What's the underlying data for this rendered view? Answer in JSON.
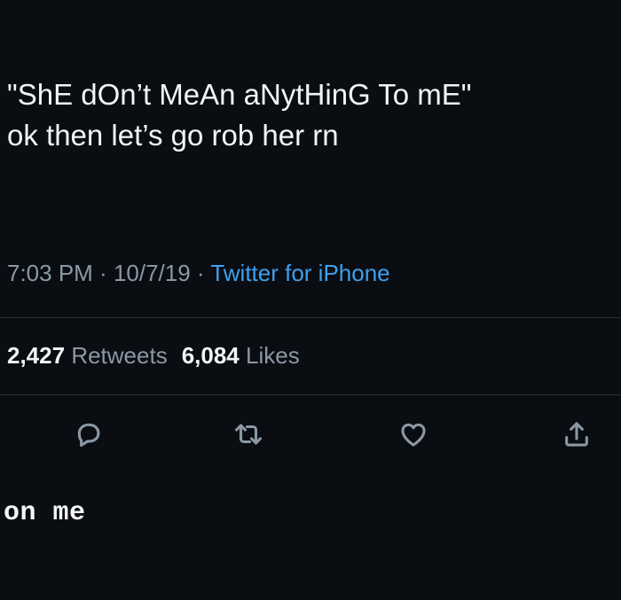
{
  "tweet": {
    "text_line_1": "\"ShE dOn’t MeAn aNytHinG To mE\"",
    "text_line_2": "ok then let’s go rob her rn",
    "time": "7:03 PM",
    "separator": " · ",
    "date": "10/7/19",
    "source": "Twitter for iPhone"
  },
  "stats": {
    "retweets_count": "2,427",
    "retweets_label": "Retweets",
    "likes_count": "6,084",
    "likes_label": "Likes"
  },
  "actions": {
    "reply_icon": "reply-icon",
    "retweet_icon": "retweet-icon",
    "like_icon": "heart-icon",
    "share_icon": "share-icon"
  },
  "caption": {
    "text": "on me"
  },
  "colors": {
    "background": "#0a0d12",
    "text": "#f2f4f6",
    "muted": "#8b98a5",
    "link": "#3ea0ee",
    "divider": "#2a2f36"
  }
}
